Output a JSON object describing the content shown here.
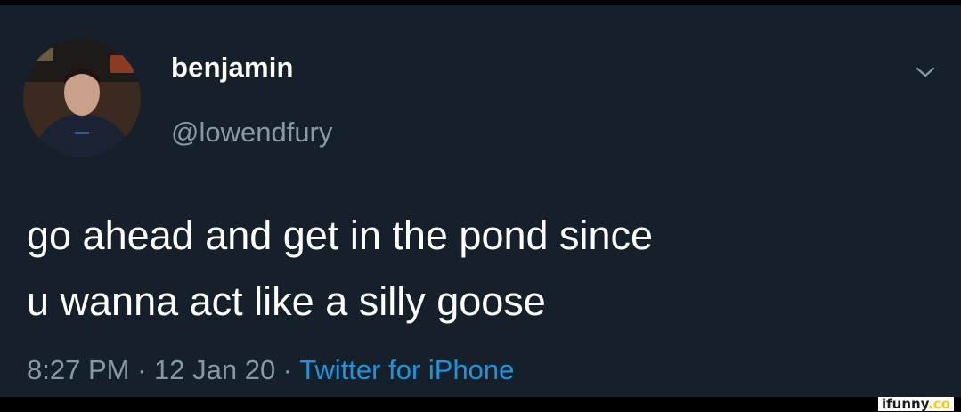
{
  "tweet": {
    "display_name": "benjamin",
    "handle": "@lowendfury",
    "text": "go ahead and get in the pond since\nu wanna act like a silly goose",
    "time": "8:27 PM",
    "separator": " · ",
    "date": "12 Jan 20",
    "source": "Twitter for iPhone",
    "menu_icon": "chevron-down-icon",
    "avatar_icon": "avatar-photo"
  },
  "watermark": {
    "brand": "ifunny",
    "suffix": ".co"
  },
  "colors": {
    "background": "#15202b",
    "text": "#ffffff",
    "secondary_text": "#8899a6",
    "link": "#1b95e0"
  }
}
